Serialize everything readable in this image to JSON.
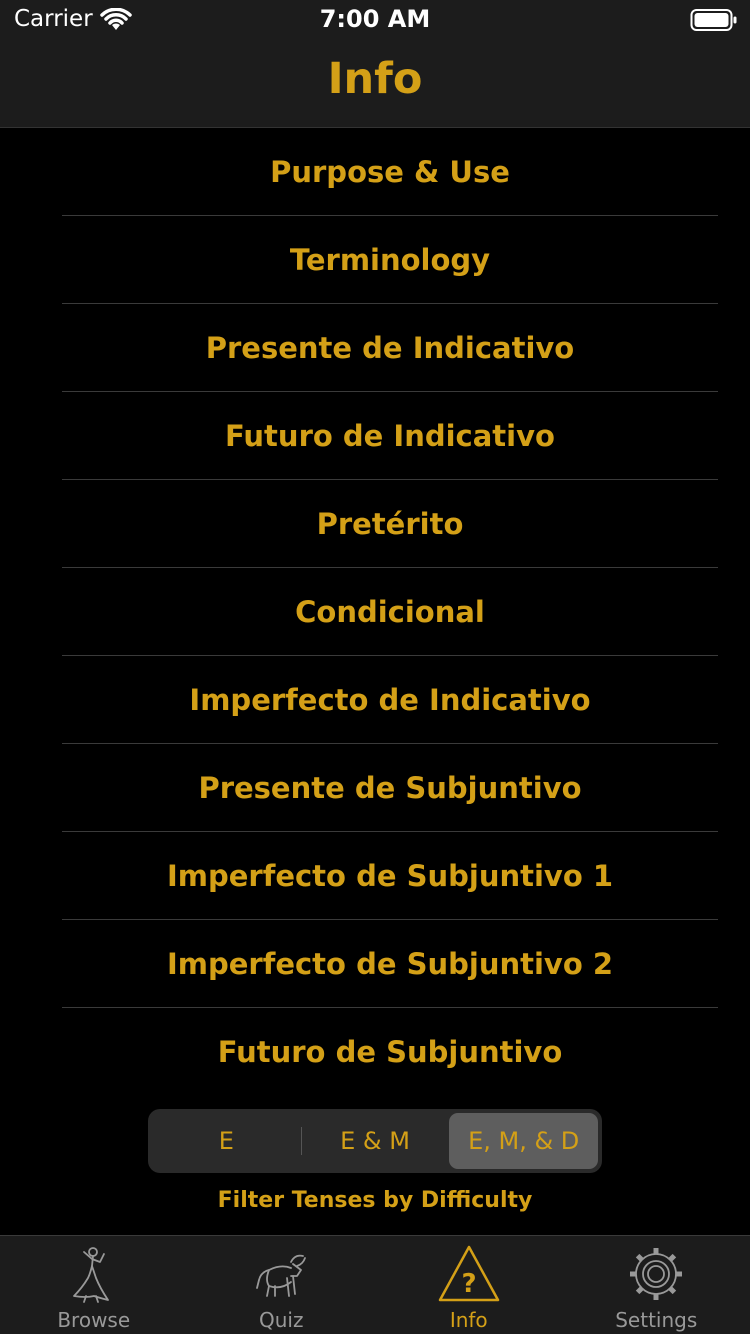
{
  "status": {
    "carrier": "Carrier",
    "time": "7:00 AM"
  },
  "nav": {
    "title": "Info"
  },
  "topics": [
    "Purpose & Use",
    "Terminology",
    "Presente de Indicativo",
    "Futuro de Indicativo",
    "Pretérito",
    "Condicional",
    "Imperfecto de Indicativo",
    "Presente de Subjuntivo",
    "Imperfecto de Subjuntivo 1",
    "Imperfecto de Subjuntivo 2",
    "Futuro de Subjuntivo"
  ],
  "difficulty": {
    "options": [
      "E",
      "E & M",
      "E, M, & D"
    ],
    "selected": "E, M, & D",
    "caption": "Filter Tenses by Difficulty"
  },
  "tabs": [
    {
      "label": "Browse",
      "icon": "dancer-icon"
    },
    {
      "label": "Quiz",
      "icon": "bull-icon"
    },
    {
      "label": "Info",
      "icon": "question-triangle-icon",
      "active": true
    },
    {
      "label": "Settings",
      "icon": "gear-icon"
    }
  ],
  "colors": {
    "accent": "#d4a017",
    "background": "#000000",
    "bar": "#1c1c1c",
    "inactive": "#999999"
  }
}
